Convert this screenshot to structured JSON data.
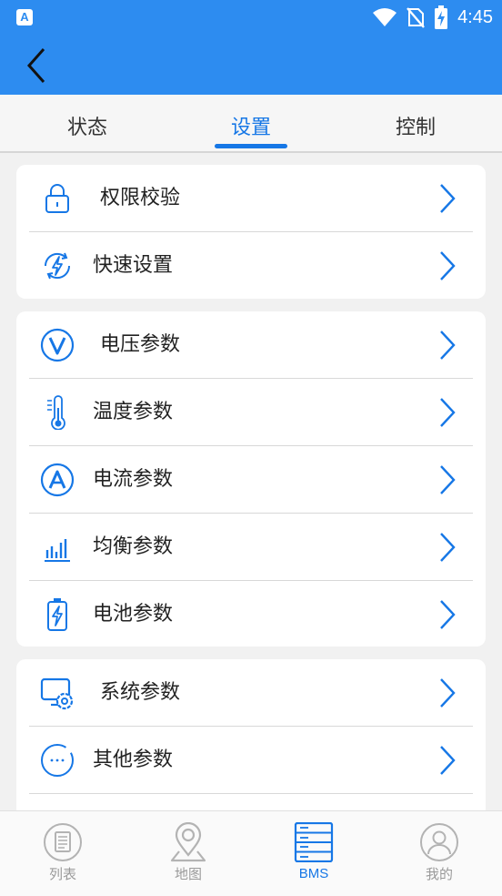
{
  "status_bar": {
    "time": "4:45",
    "app_badge": "A"
  },
  "colors": {
    "primary": "#2d8cf0",
    "accent": "#1677e6",
    "inactive": "#9a9a9a"
  },
  "tabs": [
    {
      "label": "状态",
      "active": false
    },
    {
      "label": "设置",
      "active": true
    },
    {
      "label": "控制",
      "active": false
    }
  ],
  "groups": [
    {
      "items": [
        {
          "label": "权限校验",
          "icon": "lock-icon"
        },
        {
          "label": "快速设置",
          "icon": "quick-setting-icon"
        }
      ]
    },
    {
      "items": [
        {
          "label": "电压参数",
          "icon": "voltage-icon"
        },
        {
          "label": "温度参数",
          "icon": "thermometer-icon"
        },
        {
          "label": "电流参数",
          "icon": "ampere-icon"
        },
        {
          "label": "均衡参数",
          "icon": "balance-bars-icon"
        },
        {
          "label": "电池参数",
          "icon": "battery-icon"
        }
      ]
    },
    {
      "items": [
        {
          "label": "系统参数",
          "icon": "system-settings-icon"
        },
        {
          "label": "其他参数",
          "icon": "more-dots-icon"
        }
      ]
    }
  ],
  "bottom_nav": [
    {
      "label": "列表",
      "icon": "list-icon",
      "active": false
    },
    {
      "label": "地图",
      "icon": "map-pin-icon",
      "active": false
    },
    {
      "label": "BMS",
      "icon": "bms-server-icon",
      "active": true
    },
    {
      "label": "我的",
      "icon": "profile-icon",
      "active": false
    }
  ]
}
